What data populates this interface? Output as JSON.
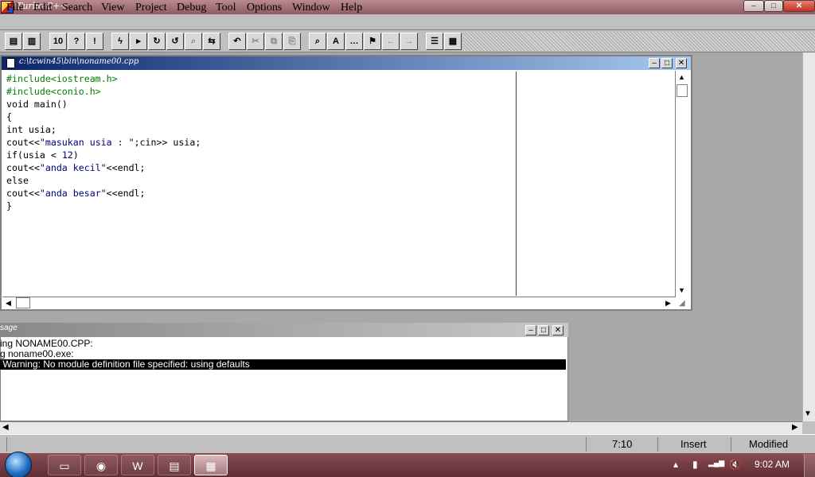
{
  "app": {
    "title": "Turbo C++"
  },
  "window_controls": {
    "minimize": "–",
    "maximize": "□",
    "close": "✕"
  },
  "menu": [
    "File",
    "Edit",
    "Search",
    "View",
    "Project",
    "Debug",
    "Tool",
    "Options",
    "Window",
    "Help"
  ],
  "toolbar": {
    "buttons": [
      {
        "icon": "open-file-icon",
        "glyph": "▤"
      },
      {
        "icon": "save-file-icon",
        "glyph": "▥"
      },
      {
        "icon": "compile-icon",
        "glyph": "10"
      },
      {
        "icon": "make-icon",
        "glyph": "?"
      },
      {
        "icon": "build-all-icon",
        "glyph": "!"
      },
      {
        "icon": "run-icon",
        "glyph": "ϟ"
      },
      {
        "icon": "step-over-icon",
        "glyph": "▸"
      },
      {
        "icon": "trace-into-icon",
        "glyph": "↻"
      },
      {
        "icon": "go-to-cursor-icon",
        "glyph": "↺"
      },
      {
        "icon": "inspect-icon",
        "glyph": "⌕"
      },
      {
        "icon": "toggle-window-icon",
        "glyph": "⇆"
      },
      {
        "icon": "undo-icon",
        "glyph": "↶"
      },
      {
        "icon": "cut-icon",
        "glyph": "✂"
      },
      {
        "icon": "copy-icon",
        "glyph": "⧉"
      },
      {
        "icon": "paste-icon",
        "glyph": "⎘"
      },
      {
        "icon": "search-icon",
        "glyph": "⌕"
      },
      {
        "icon": "replace-icon",
        "glyph": "A"
      },
      {
        "icon": "search-again-icon",
        "glyph": "…"
      },
      {
        "icon": "browse-symbol-icon",
        "glyph": "⚑"
      },
      {
        "icon": "previous-message-icon",
        "glyph": "←"
      },
      {
        "icon": "next-message-icon",
        "glyph": "→"
      },
      {
        "icon": "view-classes-icon",
        "glyph": "☰"
      },
      {
        "icon": "view-globals-icon",
        "glyph": "▦"
      }
    ]
  },
  "editor": {
    "title": "c:\\tcwin45\\bin\\noname00.cpp",
    "code_lines": [
      {
        "segments": [
          {
            "t": "#include<iostream.h>",
            "c": "pp"
          }
        ]
      },
      {
        "segments": [
          {
            "t": "#include<conio.h>",
            "c": "pp"
          }
        ]
      },
      {
        "segments": [
          {
            "t": "void main()",
            "c": ""
          }
        ]
      },
      {
        "segments": [
          {
            "t": "{",
            "c": ""
          }
        ]
      },
      {
        "segments": [
          {
            "t": "int usia;",
            "c": ""
          }
        ]
      },
      {
        "segments": [
          {
            "t": "cout<<",
            "c": ""
          },
          {
            "t": "\"masukan usia : \"",
            "c": "str"
          },
          {
            "t": ";cin>> usia;",
            "c": ""
          }
        ]
      },
      {
        "segments": [
          {
            "t": "if(usia < ",
            "c": ""
          },
          {
            "t": "12",
            "c": "num"
          },
          {
            "t": ")",
            "c": ""
          }
        ]
      },
      {
        "segments": [
          {
            "t": "cout<<",
            "c": ""
          },
          {
            "t": "\"anda kecil\"",
            "c": "str"
          },
          {
            "t": "<<endl;",
            "c": ""
          }
        ]
      },
      {
        "segments": [
          {
            "t": "else",
            "c": ""
          }
        ]
      },
      {
        "segments": [
          {
            "t": "cout<<",
            "c": ""
          },
          {
            "t": "\"anda besar\"",
            "c": "str"
          },
          {
            "t": "<<endl;",
            "c": ""
          }
        ]
      },
      {
        "segments": [
          {
            "t": "}",
            "c": ""
          }
        ]
      }
    ]
  },
  "messages": {
    "title": "sage",
    "lines": [
      "ing NONAME00.CPP:",
      "g noname00.exe:",
      " Warning: No module definition file specified: using defaults"
    ]
  },
  "status": {
    "position": "7:10",
    "mode": "Insert",
    "state": "Modified"
  },
  "taskbar": {
    "buttons": [
      {
        "icon": "explorer-icon",
        "glyph": "▭",
        "active": false
      },
      {
        "icon": "chrome-icon",
        "glyph": "◉",
        "active": false
      },
      {
        "icon": "word-icon",
        "glyph": "W",
        "active": false
      },
      {
        "icon": "notepad-icon",
        "glyph": "▤",
        "active": false
      },
      {
        "icon": "turbo-cpp-icon",
        "glyph": "▦",
        "active": true
      }
    ],
    "tray": [
      "▴",
      "▮",
      "▂▄▆",
      "🔇"
    ],
    "clock": "9:02 AM"
  },
  "colors": {
    "editor_title_start": "#0a246a",
    "preprocessor": "#008000",
    "string_literal": "#000080"
  }
}
